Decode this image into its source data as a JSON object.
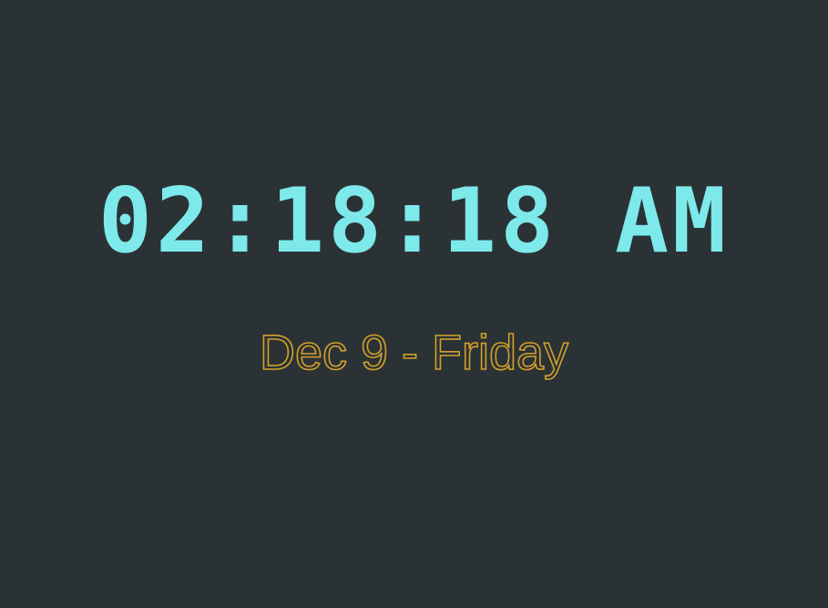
{
  "clock": {
    "time": "02:18:18 AM",
    "date": "Dec 9 - Friday"
  },
  "colors": {
    "background": "#2b3235",
    "time_color": "#7de9ea",
    "date_color": "#d3a12a"
  }
}
